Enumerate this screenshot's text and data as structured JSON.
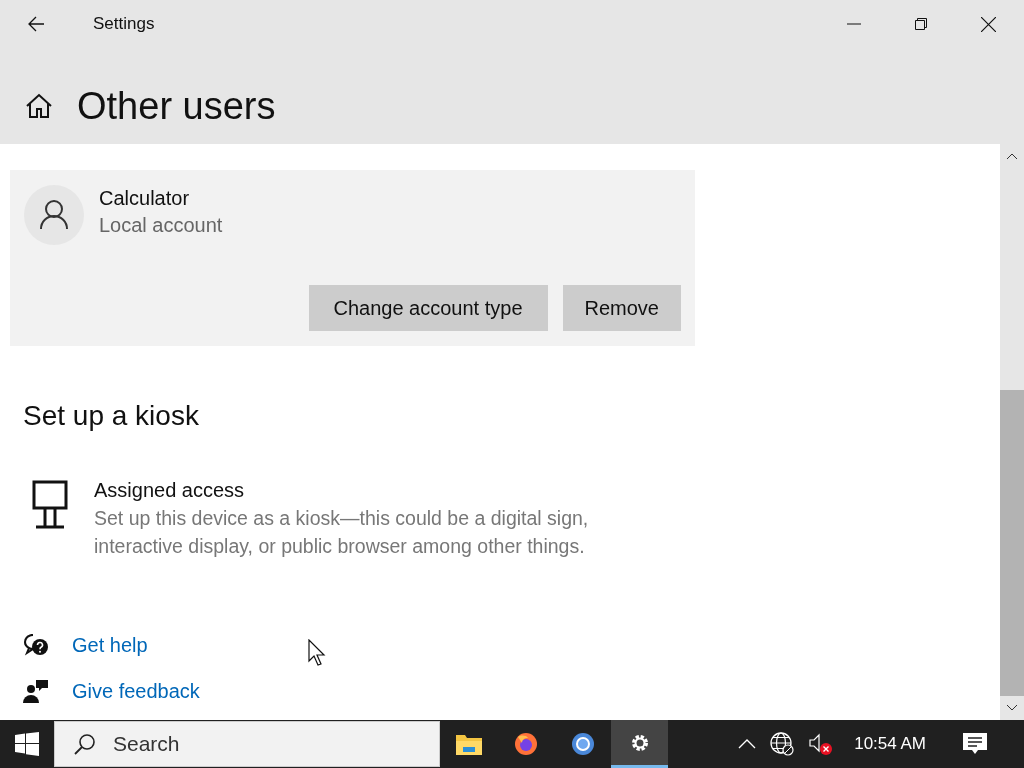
{
  "window": {
    "title": "Settings"
  },
  "header": {
    "title": "Other users"
  },
  "account": {
    "name": "Calculator",
    "type": "Local account",
    "selected": true,
    "buttons": [
      "Change account type",
      "Remove"
    ]
  },
  "kiosk": {
    "heading": "Set up a kiosk",
    "item_title": "Assigned access",
    "item_description": "Set up this device as a kiosk—this could be a digital sign, interactive display, or public browser among other things."
  },
  "help_links": [
    {
      "kind": "help",
      "label": "Get help"
    },
    {
      "kind": "feedback",
      "label": "Give feedback"
    }
  ],
  "taskbar": {
    "search": {
      "placeholder": "Search"
    },
    "apps": [
      {
        "kind": "explorer",
        "selected": false
      },
      {
        "kind": "firefox",
        "selected": false
      },
      {
        "kind": "chrome",
        "selected": false
      },
      {
        "kind": "settings",
        "selected": true
      }
    ],
    "volume_muted": true,
    "clock": "10:54 AM"
  }
}
